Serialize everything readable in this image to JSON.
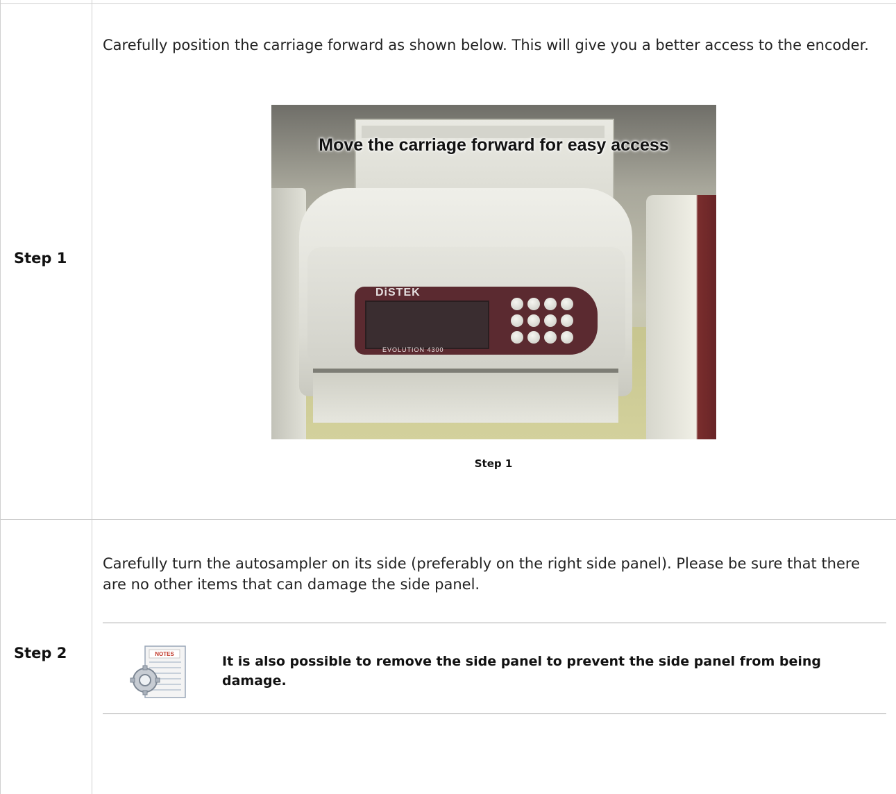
{
  "rows": [
    {
      "label": "Step 1",
      "text": "Carefully position the carriage forward as shown below. This will give you a better access to the encoder.",
      "image": {
        "overlay_text": "Move the carriage forward for easy access",
        "brand": "DiSTEK",
        "model": "EVOLUTION 4300",
        "caption": "Step 1"
      }
    },
    {
      "label": "Step 2",
      "text": "Carefully turn the autosampler on its side (preferably on the right side panel). Please be sure that there are no other items that can damage the side panel.",
      "note": {
        "icon": "notes-gear-icon",
        "icon_label": "NOTES",
        "text": "It is also possible to remove the side panel to prevent the side panel from being damage."
      }
    }
  ]
}
